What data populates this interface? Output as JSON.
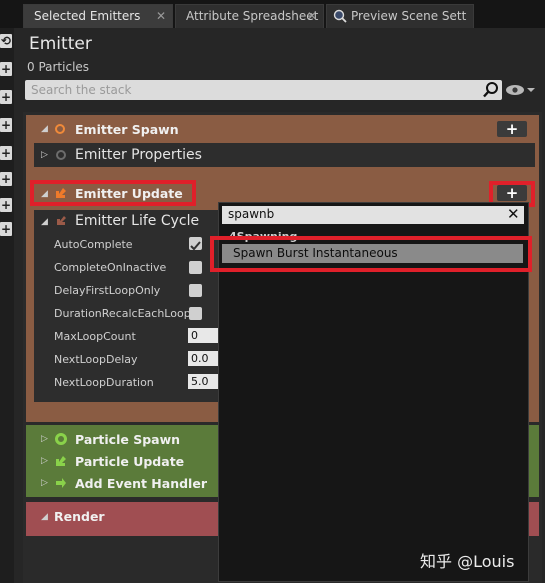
{
  "tabs": [
    {
      "label": "Selected Emitters",
      "close": "✕"
    },
    {
      "label": "Attribute Spreadsheet",
      "close": "✕"
    },
    {
      "label": "Preview Scene Sett",
      "icon": "search-icon"
    }
  ],
  "header": {
    "title": "Emitter",
    "particles": "0 Particles",
    "search_placeholder": "Search the stack"
  },
  "stack": {
    "emitter_spawn": "Emitter Spawn",
    "emitter_properties": "Emitter Properties",
    "emitter_update": "Emitter Update",
    "emitter_life_cycle": "Emitter Life Cycle",
    "properties": [
      {
        "label": "AutoComplete",
        "type": "checkbox",
        "checked": true
      },
      {
        "label": "CompleteOnInactive",
        "type": "checkbox",
        "checked": false
      },
      {
        "label": "DelayFirstLoopOnly",
        "type": "checkbox",
        "checked": false
      },
      {
        "label": "DurationRecalcEachLoop",
        "type": "checkbox",
        "checked": false
      },
      {
        "label": "MaxLoopCount",
        "type": "number",
        "value": "0"
      },
      {
        "label": "NextLoopDelay",
        "type": "number",
        "value": "0.0"
      },
      {
        "label": "NextLoopDuration",
        "type": "number",
        "value": "5.0"
      }
    ],
    "particle_spawn": "Particle Spawn",
    "particle_update": "Particle Update",
    "add_event_handler": "Add Event Handler",
    "render": "Render",
    "plus": "+"
  },
  "popup": {
    "search_value": "spawnb",
    "clear": "✕",
    "category": "4Spawning",
    "item": "Spawn Burst Instantaneous"
  },
  "watermark": "知乎 @Louis",
  "colors": {
    "highlight": "#e0202a",
    "emitter_panel": "#8a5c43",
    "particle_panel": "#5b7b3a",
    "render_panel": "#a04e52"
  }
}
